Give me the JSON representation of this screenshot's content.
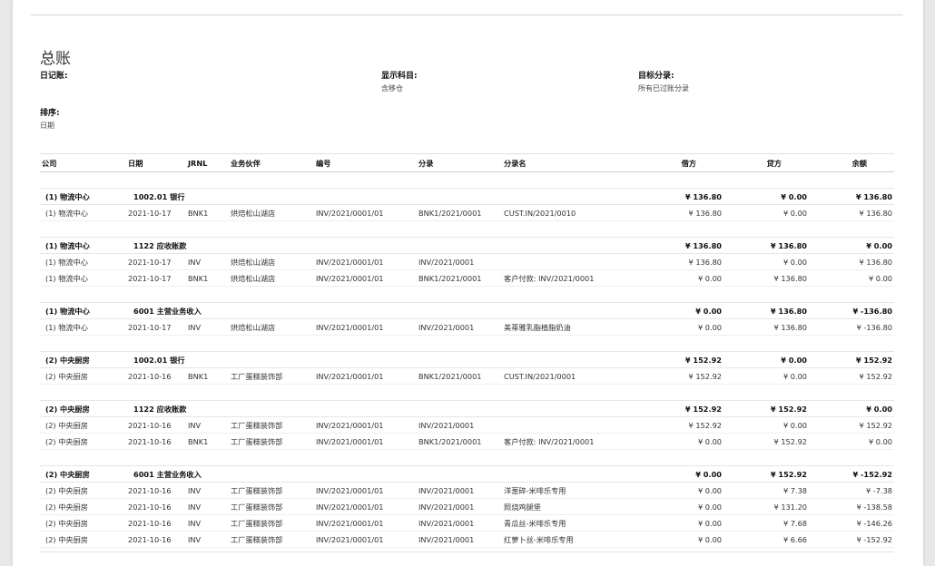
{
  "report": {
    "title": "总账",
    "journal_label": "日记账:",
    "journal_value": "",
    "display_label": "显示科目:",
    "display_value": "含移仓",
    "target_label": "目标分录:",
    "target_value": "所有已过账分录",
    "sort_label": "排序:",
    "sort_value": "日期"
  },
  "columns": {
    "company": "公司",
    "date": "日期",
    "journal": "JRNL",
    "partner": "业务伙伴",
    "ref": "编号",
    "move": "分录",
    "entry_label": "分录名",
    "debit": "借方",
    "credit": "贷方",
    "balance": "余额"
  },
  "groups": [
    {
      "company": "(1) 物流中心",
      "account": "1002.01 银行",
      "debit": "¥ 136.80",
      "credit": "¥ 0.00",
      "balance": "¥ 136.80",
      "lines": [
        {
          "company": "(1) 物流中心",
          "date": "2021-10-17",
          "journal": "BNK1",
          "partner": "烘焙松山湖店",
          "ref": "INV/2021/0001/01",
          "move": "BNK1/2021/0001",
          "label": "CUST.IN/2021/0010",
          "debit": "¥ 136.80",
          "credit": "¥ 0.00",
          "balance": "¥ 136.80"
        }
      ]
    },
    {
      "company": "(1) 物流中心",
      "account": "1122 应收账款",
      "debit": "¥ 136.80",
      "credit": "¥ 136.80",
      "balance": "¥ 0.00",
      "lines": [
        {
          "company": "(1) 物流中心",
          "date": "2021-10-17",
          "journal": "INV",
          "partner": "烘焙松山湖店",
          "ref": "INV/2021/0001/01",
          "move": "INV/2021/0001",
          "label": "",
          "debit": "¥ 136.80",
          "credit": "¥ 0.00",
          "balance": "¥ 136.80"
        },
        {
          "company": "(1) 物流中心",
          "date": "2021-10-17",
          "journal": "BNK1",
          "partner": "烘焙松山湖店",
          "ref": "INV/2021/0001/01",
          "move": "BNK1/2021/0001",
          "label": "客户付款: INV/2021/0001",
          "debit": "¥ 0.00",
          "credit": "¥ 136.80",
          "balance": "¥ 0.00"
        }
      ]
    },
    {
      "company": "(1) 物流中心",
      "account": "6001 主营业务收入",
      "debit": "¥ 0.00",
      "credit": "¥ 136.80",
      "balance": "¥ -136.80",
      "lines": [
        {
          "company": "(1) 物流中心",
          "date": "2021-10-17",
          "journal": "INV",
          "partner": "烘焙松山湖店",
          "ref": "INV/2021/0001/01",
          "move": "INV/2021/0001",
          "label": "美蒂雅乳脂植脂奶油",
          "debit": "¥ 0.00",
          "credit": "¥ 136.80",
          "balance": "¥ -136.80"
        }
      ]
    },
    {
      "company": "(2) 中央厨房",
      "account": "1002.01 银行",
      "debit": "¥ 152.92",
      "credit": "¥ 0.00",
      "balance": "¥ 152.92",
      "lines": [
        {
          "company": "(2) 中央厨房",
          "date": "2021-10-16",
          "journal": "BNK1",
          "partner": "工厂蛋糕装饰部",
          "ref": "INV/2021/0001/01",
          "move": "BNK1/2021/0001",
          "label": "CUST.IN/2021/0001",
          "debit": "¥ 152.92",
          "credit": "¥ 0.00",
          "balance": "¥ 152.92"
        }
      ]
    },
    {
      "company": "(2) 中央厨房",
      "account": "1122 应收账款",
      "debit": "¥ 152.92",
      "credit": "¥ 152.92",
      "balance": "¥ 0.00",
      "lines": [
        {
          "company": "(2) 中央厨房",
          "date": "2021-10-16",
          "journal": "INV",
          "partner": "工厂蛋糕装饰部",
          "ref": "INV/2021/0001/01",
          "move": "INV/2021/0001",
          "label": "",
          "debit": "¥ 152.92",
          "credit": "¥ 0.00",
          "balance": "¥ 152.92"
        },
        {
          "company": "(2) 中央厨房",
          "date": "2021-10-16",
          "journal": "BNK1",
          "partner": "工厂蛋糕装饰部",
          "ref": "INV/2021/0001/01",
          "move": "BNK1/2021/0001",
          "label": "客户付款: INV/2021/0001",
          "debit": "¥ 0.00",
          "credit": "¥ 152.92",
          "balance": "¥ 0.00"
        }
      ]
    },
    {
      "company": "(2) 中央厨房",
      "account": "6001 主营业务收入",
      "debit": "¥ 0.00",
      "credit": "¥ 152.92",
      "balance": "¥ -152.92",
      "lines": [
        {
          "company": "(2) 中央厨房",
          "date": "2021-10-16",
          "journal": "INV",
          "partner": "工厂蛋糕装饰部",
          "ref": "INV/2021/0001/01",
          "move": "INV/2021/0001",
          "label": "洋葱碎-米啡乐专用",
          "debit": "¥ 0.00",
          "credit": "¥ 7.38",
          "balance": "¥ -7.38"
        },
        {
          "company": "(2) 中央厨房",
          "date": "2021-10-16",
          "journal": "INV",
          "partner": "工厂蛋糕装饰部",
          "ref": "INV/2021/0001/01",
          "move": "INV/2021/0001",
          "label": "照烧鸡腿堡",
          "debit": "¥ 0.00",
          "credit": "¥ 131.20",
          "balance": "¥ -138.58"
        },
        {
          "company": "(2) 中央厨房",
          "date": "2021-10-16",
          "journal": "INV",
          "partner": "工厂蛋糕装饰部",
          "ref": "INV/2021/0001/01",
          "move": "INV/2021/0001",
          "label": "青瓜丝-米啡乐专用",
          "debit": "¥ 0.00",
          "credit": "¥ 7.68",
          "balance": "¥ -146.26"
        },
        {
          "company": "(2) 中央厨房",
          "date": "2021-10-16",
          "journal": "INV",
          "partner": "工厂蛋糕装饰部",
          "ref": "INV/2021/0001/01",
          "move": "INV/2021/0001",
          "label": "红萝卜丝-米啡乐专用",
          "debit": "¥ 0.00",
          "credit": "¥ 6.66",
          "balance": "¥ -152.92"
        }
      ]
    }
  ]
}
